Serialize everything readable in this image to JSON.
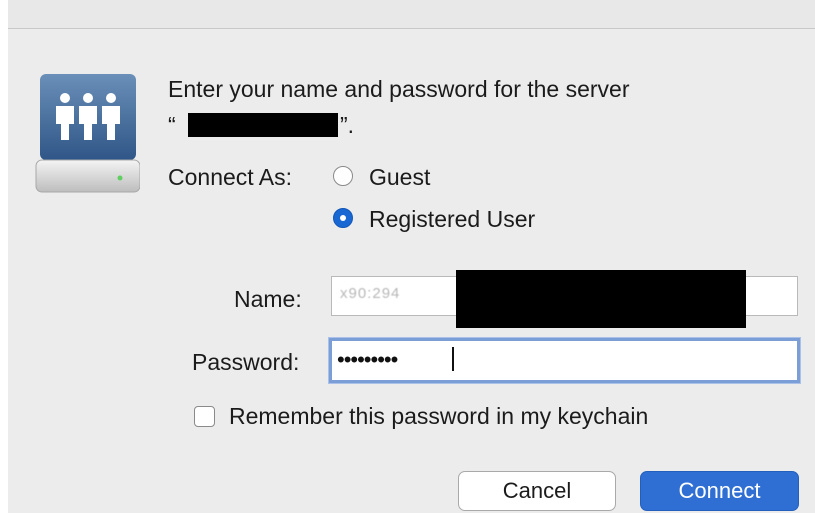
{
  "dialog": {
    "prompt_line1": "Enter your name and password for the server",
    "prompt_open_quote": "“",
    "prompt_close_quote": "”.",
    "connect_as_label": "Connect As:",
    "options": [
      {
        "label": "Guest",
        "selected": false
      },
      {
        "label": "Registered User",
        "selected": true
      }
    ],
    "name_label": "Name:",
    "name_value": "x90:294",
    "password_label": "Password:",
    "password_value": "•••••••••",
    "remember_label": "Remember this password in my keychain",
    "remember_checked": false,
    "cancel_label": "Cancel",
    "connect_label": "Connect"
  },
  "colors": {
    "accent": "#2f6fd4",
    "focus_ring": "#7c9ed6"
  },
  "icons": {
    "server": "server-icon"
  }
}
